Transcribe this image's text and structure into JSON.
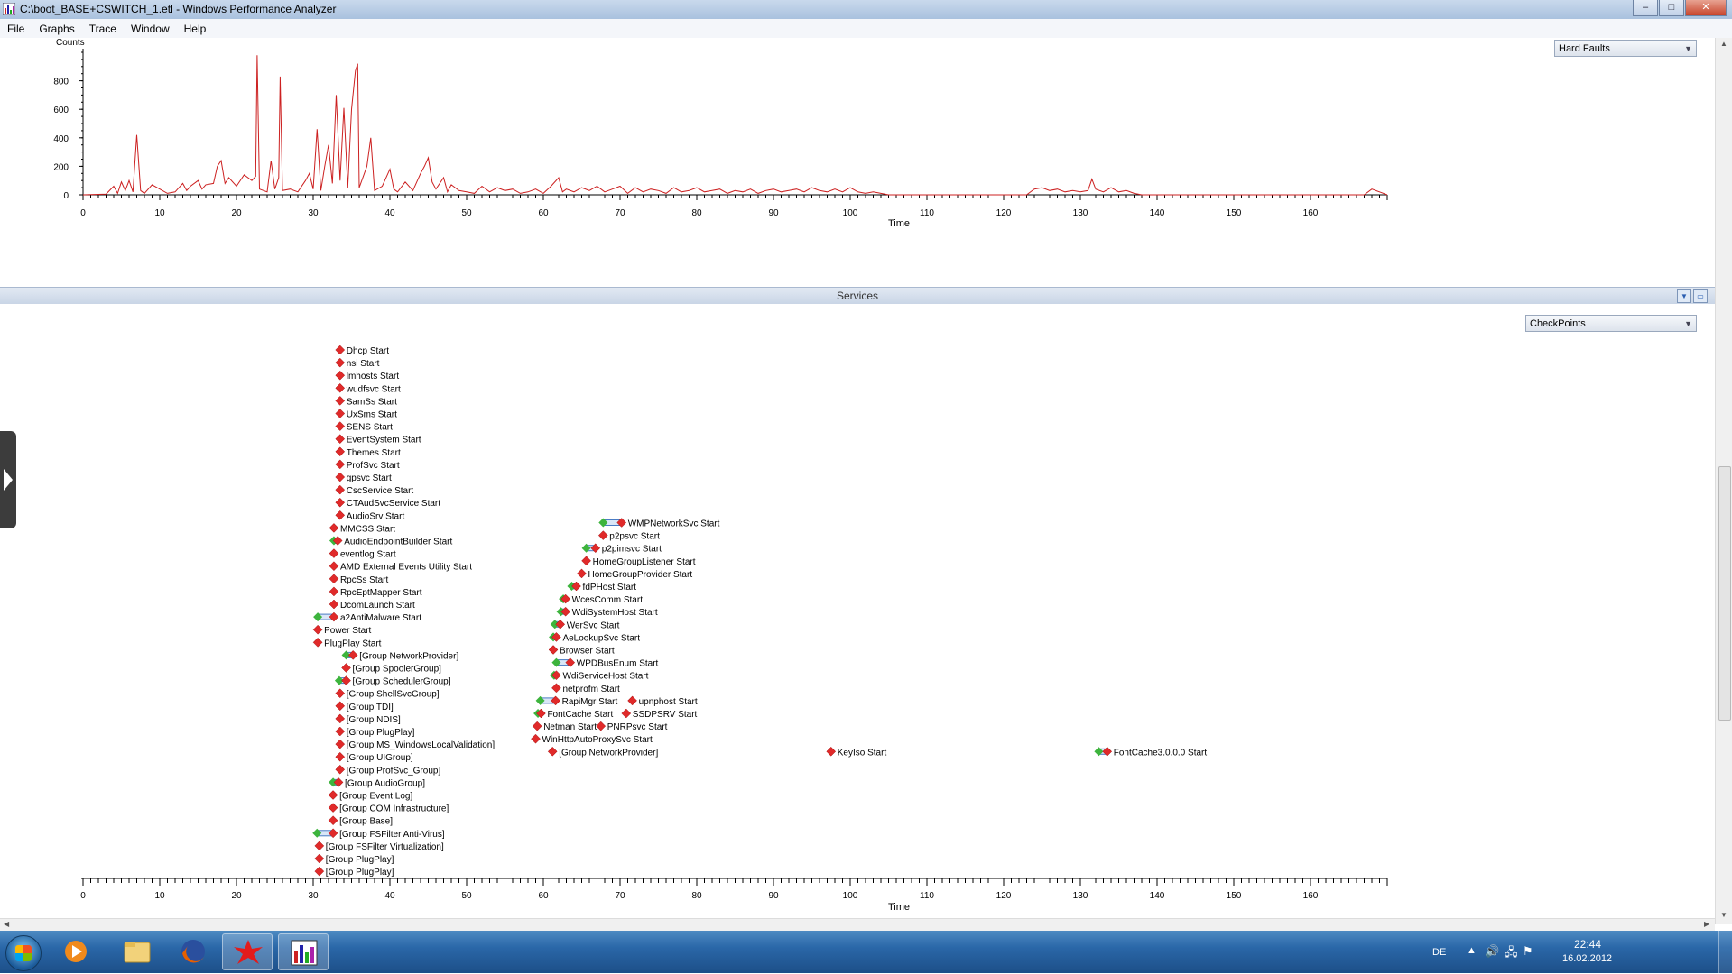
{
  "window": {
    "title": "C:\\boot_BASE+CSWITCH_1.etl - Windows Performance Analyzer",
    "buttons": {
      "minimize": "–",
      "maximize": "□",
      "close": "✕"
    }
  },
  "menu": [
    "File",
    "Graphs",
    "Trace",
    "Window",
    "Help"
  ],
  "graph_top": {
    "dropdown": "Hard Faults",
    "ylabel": "Counts",
    "xlabel": "Time",
    "x_ticks": [
      "0",
      "10",
      "20",
      "30",
      "40",
      "50",
      "60",
      "70",
      "80",
      "90",
      "100",
      "110",
      "120",
      "130",
      "140",
      "150",
      "160"
    ],
    "y_ticks": [
      "0",
      "200",
      "400",
      "600",
      "800"
    ]
  },
  "separator": {
    "label": "Services"
  },
  "graph_bottom": {
    "dropdown": "CheckPoints",
    "xlabel": "Time",
    "x_ticks": [
      "0",
      "10",
      "20",
      "30",
      "40",
      "50",
      "60",
      "70",
      "80",
      "90",
      "100",
      "110",
      "120",
      "130",
      "140",
      "150",
      "160"
    ]
  },
  "chart_data": [
    {
      "type": "line",
      "ylabel": "Counts",
      "xlabel": "Time",
      "xlim": [
        0,
        170
      ],
      "ylim": [
        0,
        1000
      ],
      "grid": false,
      "series": [
        {
          "color": "#cc2020",
          "points": [
            [
              0,
              0
            ],
            [
              3,
              5
            ],
            [
              4,
              60
            ],
            [
              4.5,
              10
            ],
            [
              5,
              90
            ],
            [
              5.5,
              30
            ],
            [
              6,
              100
            ],
            [
              6.5,
              20
            ],
            [
              7,
              420
            ],
            [
              7.5,
              30
            ],
            [
              8,
              10
            ],
            [
              9,
              70
            ],
            [
              10,
              40
            ],
            [
              11,
              10
            ],
            [
              12,
              20
            ],
            [
              13,
              80
            ],
            [
              13.5,
              30
            ],
            [
              14,
              60
            ],
            [
              15,
              100
            ],
            [
              15.5,
              40
            ],
            [
              16,
              70
            ],
            [
              17,
              80
            ],
            [
              17.5,
              200
            ],
            [
              18,
              240
            ],
            [
              18.5,
              80
            ],
            [
              19,
              120
            ],
            [
              20,
              60
            ],
            [
              21,
              140
            ],
            [
              22,
              100
            ],
            [
              22.5,
              130
            ],
            [
              22.7,
              980
            ],
            [
              23,
              40
            ],
            [
              24,
              20
            ],
            [
              24.5,
              240
            ],
            [
              25,
              40
            ],
            [
              25.5,
              120
            ],
            [
              25.7,
              830
            ],
            [
              26,
              30
            ],
            [
              27,
              40
            ],
            [
              28,
              20
            ],
            [
              29,
              100
            ],
            [
              29.5,
              150
            ],
            [
              30,
              40
            ],
            [
              30.5,
              460
            ],
            [
              31,
              30
            ],
            [
              31.5,
              200
            ],
            [
              32,
              350
            ],
            [
              32.5,
              80
            ],
            [
              33,
              700
            ],
            [
              33.5,
              100
            ],
            [
              34,
              610
            ],
            [
              34.5,
              50
            ],
            [
              35,
              600
            ],
            [
              35.5,
              870
            ],
            [
              35.8,
              920
            ],
            [
              36,
              50
            ],
            [
              37,
              200
            ],
            [
              37.5,
              400
            ],
            [
              38,
              30
            ],
            [
              39,
              60
            ],
            [
              40,
              180
            ],
            [
              40.5,
              40
            ],
            [
              41,
              20
            ],
            [
              42,
              90
            ],
            [
              43,
              30
            ],
            [
              44,
              150
            ],
            [
              44.5,
              200
            ],
            [
              45,
              260
            ],
            [
              45.5,
              90
            ],
            [
              46,
              40
            ],
            [
              47,
              120
            ],
            [
              47.5,
              20
            ],
            [
              48,
              70
            ],
            [
              49,
              30
            ],
            [
              50,
              20
            ],
            [
              51,
              10
            ],
            [
              52,
              60
            ],
            [
              53,
              20
            ],
            [
              54,
              50
            ],
            [
              55,
              30
            ],
            [
              56,
              40
            ],
            [
              57,
              10
            ],
            [
              58,
              20
            ],
            [
              59,
              40
            ],
            [
              60,
              10
            ],
            [
              61,
              60
            ],
            [
              62,
              120
            ],
            [
              62.5,
              20
            ],
            [
              63,
              40
            ],
            [
              64,
              20
            ],
            [
              65,
              50
            ],
            [
              66,
              30
            ],
            [
              67,
              60
            ],
            [
              68,
              20
            ],
            [
              69,
              40
            ],
            [
              70,
              60
            ],
            [
              71,
              10
            ],
            [
              72,
              50
            ],
            [
              73,
              20
            ],
            [
              74,
              40
            ],
            [
              75,
              30
            ],
            [
              76,
              10
            ],
            [
              77,
              50
            ],
            [
              78,
              20
            ],
            [
              79,
              30
            ],
            [
              80,
              50
            ],
            [
              81,
              20
            ],
            [
              82,
              30
            ],
            [
              83,
              40
            ],
            [
              84,
              10
            ],
            [
              85,
              30
            ],
            [
              86,
              20
            ],
            [
              87,
              40
            ],
            [
              88,
              10
            ],
            [
              89,
              30
            ],
            [
              90,
              40
            ],
            [
              91,
              20
            ],
            [
              92,
              30
            ],
            [
              93,
              40
            ],
            [
              94,
              20
            ],
            [
              95,
              50
            ],
            [
              96,
              30
            ],
            [
              97,
              20
            ],
            [
              98,
              40
            ],
            [
              99,
              20
            ],
            [
              100,
              50
            ],
            [
              101,
              20
            ],
            [
              102,
              10
            ],
            [
              103,
              20
            ],
            [
              104,
              10
            ],
            [
              105,
              0
            ],
            [
              123,
              0
            ],
            [
              124,
              40
            ],
            [
              125,
              50
            ],
            [
              126,
              30
            ],
            [
              127,
              40
            ],
            [
              128,
              20
            ],
            [
              129,
              30
            ],
            [
              130,
              20
            ],
            [
              131,
              30
            ],
            [
              131.5,
              110
            ],
            [
              132,
              40
            ],
            [
              133,
              20
            ],
            [
              134,
              50
            ],
            [
              135,
              20
            ],
            [
              136,
              30
            ],
            [
              137,
              10
            ],
            [
              138,
              0
            ],
            [
              167,
              0
            ],
            [
              168,
              40
            ],
            [
              169,
              20
            ],
            [
              170,
              0
            ]
          ]
        }
      ]
    },
    {
      "type": "scatter",
      "xlabel": "Time",
      "xlim": [
        0,
        170
      ],
      "events": [
        {
          "label": "Dhcp Start",
          "t": 33.5,
          "start": 33.5
        },
        {
          "label": "nsi Start",
          "t": 33.5,
          "start": 33.5
        },
        {
          "label": "lmhosts Start",
          "t": 33.5,
          "start": 33.5
        },
        {
          "label": "wudfsvc Start",
          "t": 33.5,
          "start": 33.5
        },
        {
          "label": "SamSs Start",
          "t": 33.5,
          "start": 33.5
        },
        {
          "label": "UxSms Start",
          "t": 33.5,
          "start": 33.5
        },
        {
          "label": "SENS Start",
          "t": 33.5,
          "start": 33.5
        },
        {
          "label": "EventSystem Start",
          "t": 33.5,
          "start": 33.5
        },
        {
          "label": "Themes Start",
          "t": 33.5,
          "start": 33.5
        },
        {
          "label": "ProfSvc Start",
          "t": 33.5,
          "start": 33.5
        },
        {
          "label": "gpsvc Start",
          "t": 33.5,
          "start": 33.5
        },
        {
          "label": "CscService Start",
          "t": 33.5,
          "start": 33.5
        },
        {
          "label": "CTAudSvcService Start",
          "t": 33.5,
          "start": 33.5
        },
        {
          "label": "AudioSrv Start",
          "t": 33.5,
          "start": 33.5
        },
        {
          "label": "MMCSS Start",
          "t": 32.7,
          "start": 32.7
        },
        {
          "label": "AudioEndpointBuilder Start",
          "t": 33.2,
          "start": 32.7
        },
        {
          "label": "eventlog Start",
          "t": 32.7,
          "start": 32.7
        },
        {
          "label": "AMD External Events Utility Start",
          "t": 32.7,
          "start": 32.7
        },
        {
          "label": "RpcSs Start",
          "t": 32.7,
          "start": 32.7
        },
        {
          "label": "RpcEptMapper Start",
          "t": 32.7,
          "start": 32.7
        },
        {
          "label": "DcomLaunch Start",
          "t": 32.7,
          "start": 32.7
        },
        {
          "label": "a2AntiMalware Start",
          "t": 32.7,
          "start": 30.6
        },
        {
          "label": "Power Start",
          "t": 30.6,
          "start": 30.6
        },
        {
          "label": "PlugPlay Start",
          "t": 30.6,
          "start": 30.6
        },
        {
          "label": "[Group NetworkProvider]",
          "t": 35.2,
          "start": 34.3
        },
        {
          "label": "[Group SpoolerGroup]",
          "t": 34.3,
          "start": 34.3
        },
        {
          "label": "[Group SchedulerGroup]",
          "t": 34.3,
          "start": 33.4
        },
        {
          "label": "[Group ShellSvcGroup]",
          "t": 33.5,
          "start": 33.5
        },
        {
          "label": "[Group TDI]",
          "t": 33.5,
          "start": 33.5
        },
        {
          "label": "[Group NDIS]",
          "t": 33.5,
          "start": 33.5
        },
        {
          "label": "[Group PlugPlay]",
          "t": 33.5,
          "start": 33.5
        },
        {
          "label": "[Group MS_WindowsLocalValidation]",
          "t": 33.5,
          "start": 33.5
        },
        {
          "label": "[Group UIGroup]",
          "t": 33.5,
          "start": 33.5
        },
        {
          "label": "[Group ProfSvc_Group]",
          "t": 33.5,
          "start": 33.5
        },
        {
          "label": "[Group AudioGroup]",
          "t": 33.3,
          "start": 32.6
        },
        {
          "label": "[Group Event Log]",
          "t": 32.6,
          "start": 32.6
        },
        {
          "label": "[Group COM Infrastructure]",
          "t": 32.6,
          "start": 32.6
        },
        {
          "label": "[Group Base]",
          "t": 32.6,
          "start": 32.6
        },
        {
          "label": "[Group FSFilter Anti-Virus]",
          "t": 32.6,
          "start": 30.5
        },
        {
          "label": "[Group FSFilter Virtualization]",
          "t": 30.8,
          "start": 30.8
        },
        {
          "label": "[Group PlugPlay]",
          "t": 30.8,
          "start": 30.8
        },
        {
          "label": "[Group PlugPlay]",
          "t": 30.8,
          "start": 30.8
        },
        {
          "label": "WMPNetworkSvc Start",
          "t": 70.2,
          "start": 67.8
        },
        {
          "label": "p2psvc Start",
          "t": 67.8,
          "start": 67.8
        },
        {
          "label": "p2pimsvc Start",
          "t": 66.8,
          "start": 65.6
        },
        {
          "label": "HomeGroupListener Start",
          "t": 65.6,
          "start": 65.6
        },
        {
          "label": "HomeGroupProvider Start",
          "t": 65.0,
          "start": 65.0
        },
        {
          "label": "fdPHost Start",
          "t": 64.3,
          "start": 63.7
        },
        {
          "label": "WcesComm Start",
          "t": 62.9,
          "start": 62.6
        },
        {
          "label": "WdiSystemHost Start",
          "t": 62.9,
          "start": 62.3
        },
        {
          "label": "WerSvc Start",
          "t": 62.2,
          "start": 61.5
        },
        {
          "label": "AeLookupSvc Start",
          "t": 61.7,
          "start": 61.3
        },
        {
          "label": "Browser Start",
          "t": 61.3,
          "start": 61.3
        },
        {
          "label": "WPDBusEnum Start",
          "t": 63.5,
          "start": 61.7
        },
        {
          "label": "WdiServiceHost Start",
          "t": 61.7,
          "start": 61.4
        },
        {
          "label": "netprofm Start",
          "t": 61.7,
          "start": 61.7
        },
        {
          "label": "RapiMgr Start",
          "t": 61.6,
          "start": 59.6
        },
        {
          "label": "upnphost Start",
          "t": 71.6,
          "start": 71.6
        },
        {
          "label": "FontCache Start",
          "t": 59.7,
          "start": 59.3
        },
        {
          "label": "SSDPSRV Start",
          "t": 70.8,
          "start": 70.6
        },
        {
          "label": "Netman Start",
          "t": 59.2,
          "start": 59.2
        },
        {
          "label": "PNRPsvc Start",
          "t": 67.5,
          "start": 67.3
        },
        {
          "label": "WinHttpAutoProxySvc Start",
          "t": 59.0,
          "start": 59.0
        },
        {
          "label": "[Group NetworkProvider]",
          "t": 61.2,
          "start": 61.2
        },
        {
          "label": "KeyIso Start",
          "t": 97.5,
          "start": 97.5
        },
        {
          "label": "FontCache3.0.0.0 Start",
          "t": 133.5,
          "start": 132.4
        }
      ]
    }
  ],
  "taskbar": {
    "language": "DE",
    "time": "22:44",
    "date": "16.02.2012"
  }
}
